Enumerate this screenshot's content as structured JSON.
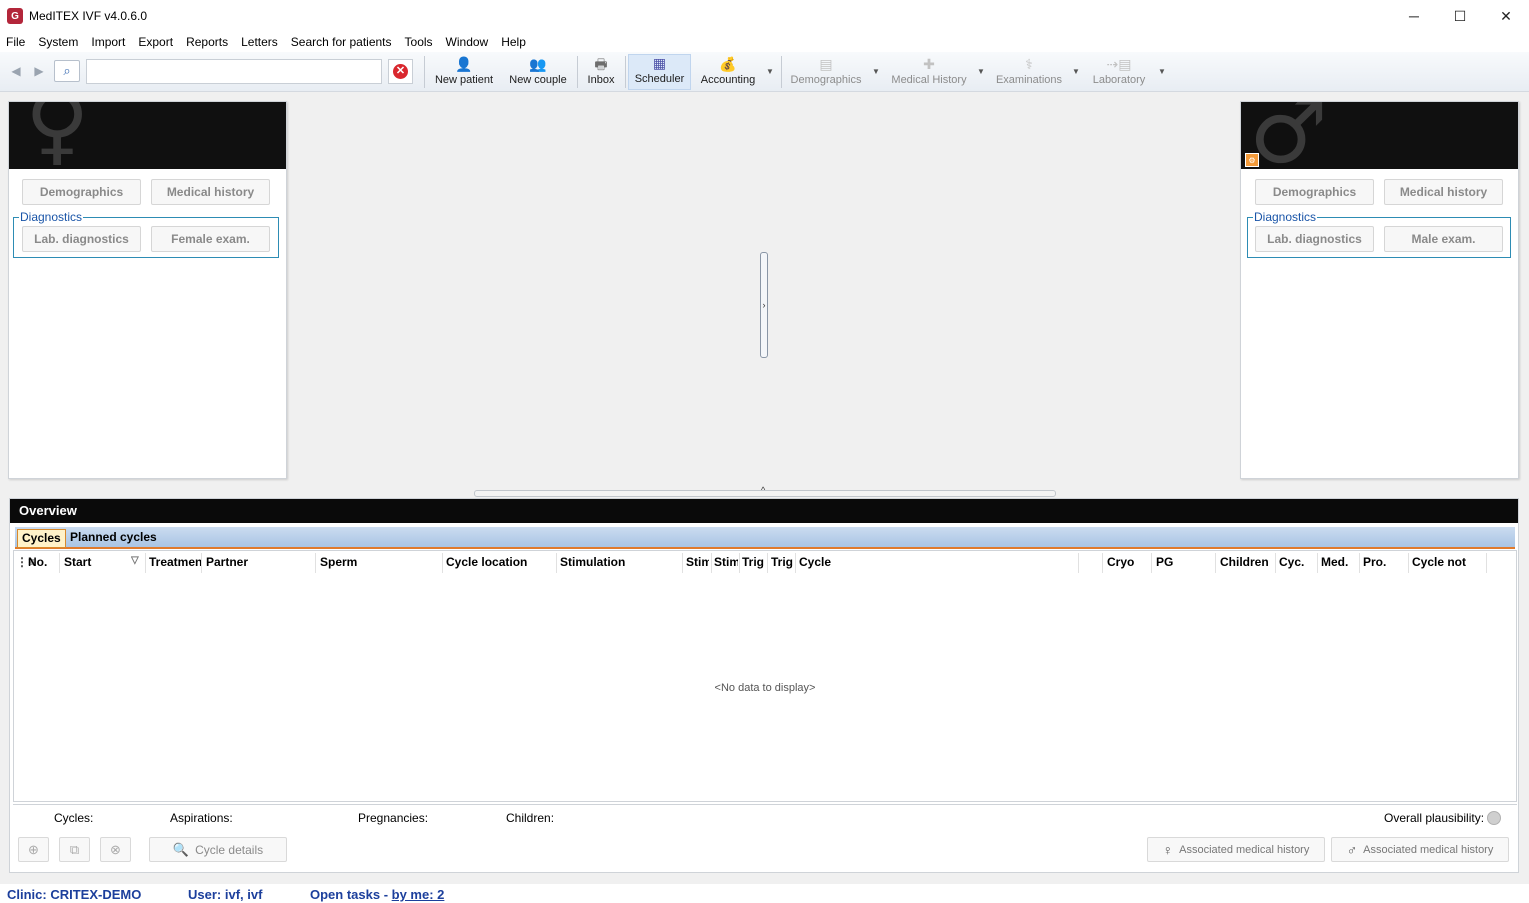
{
  "window": {
    "title": "MedITEX IVF v4.0.6.0",
    "app_icon_glyph": "G"
  },
  "window_controls": {
    "minimize": "─",
    "maximize": "☐",
    "close": "✕"
  },
  "menu": [
    "File",
    "System",
    "Import",
    "Export",
    "Reports",
    "Letters",
    "Search for patients",
    "Tools",
    "Window",
    "Help"
  ],
  "toolbar": {
    "search_value": "",
    "buttons": {
      "new_patient": "New patient",
      "new_couple": "New couple",
      "inbox": "Inbox",
      "scheduler": "Scheduler",
      "accounting": "Accounting",
      "demographics": "Demographics",
      "medical_history": "Medical History",
      "examinations": "Examinations",
      "laboratory": "Laboratory"
    }
  },
  "female_panel": {
    "demographics": "Demographics",
    "medical_history": "Medical history",
    "diagnostics_label": "Diagnostics",
    "lab_diagnostics": "Lab. diagnostics",
    "exam": "Female exam."
  },
  "male_panel": {
    "demographics": "Demographics",
    "medical_history": "Medical history",
    "diagnostics_label": "Diagnostics",
    "lab_diagnostics": "Lab. diagnostics",
    "exam": "Male exam."
  },
  "overview": {
    "title": "Overview",
    "tabs": {
      "cycles": "Cycles",
      "planned": "Planned cycles"
    },
    "columns": [
      "No.",
      "Start",
      "Treatmen",
      "Partner",
      "Sperm",
      "Cycle location",
      "Stimulation",
      "Stim",
      "Stim",
      "Trig",
      "Trig",
      "Cycle",
      "Cryo",
      "PG",
      "Children",
      "Cyc.",
      "Med.",
      "Pro.",
      "Cycle not"
    ],
    "rows": [],
    "no_data": "<No data to display>",
    "summary": {
      "cycles": "Cycles:",
      "aspirations": "Aspirations:",
      "pregnancies": "Pregnancies:",
      "children": "Children:",
      "plausibility": "Overall plausibility:"
    },
    "footer": {
      "cycle_details": "Cycle details",
      "assoc_female": "Associated medical history",
      "assoc_male": "Associated medical history"
    }
  },
  "status": {
    "clinic": "Clinic: CRITEX-DEMO",
    "user": "User: ivf, ivf",
    "open_tasks": "Open tasks - ",
    "by_me": "by me: 2"
  }
}
